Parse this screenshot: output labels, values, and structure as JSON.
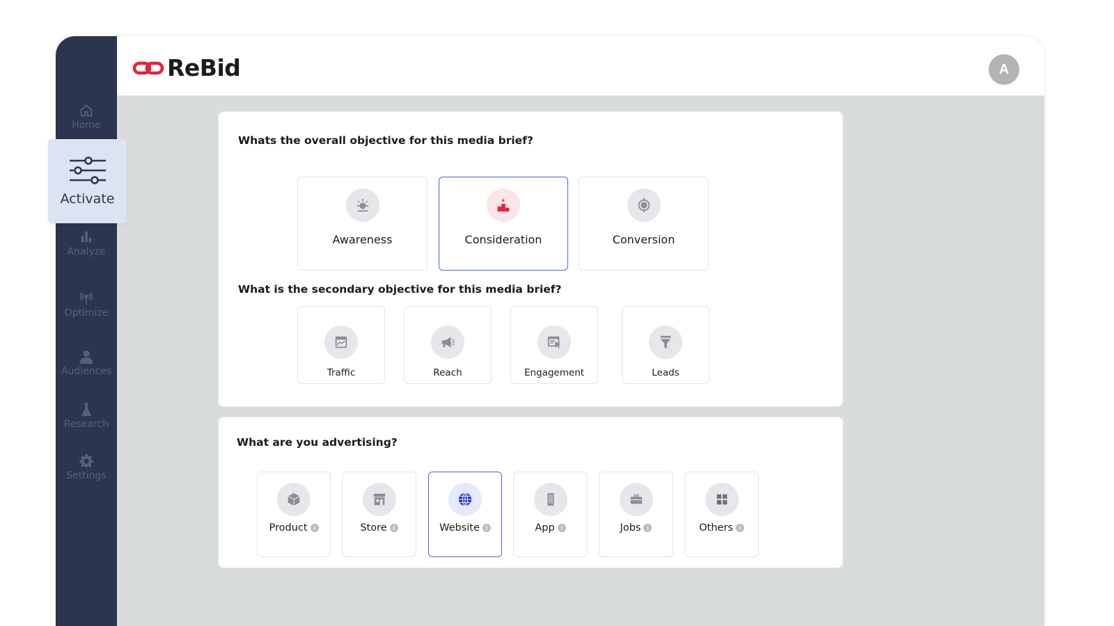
{
  "app": {
    "logo_text": "ReBid",
    "avatar_initial": "A"
  },
  "colors": {
    "sidebar": "#2b3550",
    "accent_blue": "#4a64d8",
    "brand_red": "#e8203a",
    "nav_active_bg": "#dde3f3"
  },
  "sidebar": {
    "items": [
      {
        "label": "Home",
        "icon": "home-icon"
      },
      {
        "label": "Activate",
        "icon": "sliders-icon",
        "active": true
      },
      {
        "label": "Analyze",
        "icon": "bar-chart-icon"
      },
      {
        "label": "Optimize",
        "icon": "broadcast-icon"
      },
      {
        "label": "Audiences",
        "icon": "user-icon"
      },
      {
        "label": "Research",
        "icon": "flask-icon"
      },
      {
        "label": "Settings",
        "icon": "gear-icon"
      }
    ]
  },
  "objective": {
    "question": "Whats the overall objective for this media brief?",
    "options": [
      {
        "label": "Awareness",
        "icon": "sun-icon"
      },
      {
        "label": "Consideration",
        "icon": "podium-icon",
        "selected": true
      },
      {
        "label": "Conversion",
        "icon": "target-icon"
      }
    ]
  },
  "secondary": {
    "question": "What is the secondary objective for this media brief?",
    "options": [
      {
        "label": "Traffic",
        "icon": "traffic-chart-icon"
      },
      {
        "label": "Reach",
        "icon": "megaphone-icon"
      },
      {
        "label": "Engagement",
        "icon": "cursor-window-icon"
      },
      {
        "label": "Leads",
        "icon": "funnel-icon"
      }
    ]
  },
  "advertising": {
    "question": "What are you advertising?",
    "options": [
      {
        "label": "Product",
        "icon": "box-icon"
      },
      {
        "label": "Store",
        "icon": "storefront-icon"
      },
      {
        "label": "Website",
        "icon": "globe-icon",
        "selected": true
      },
      {
        "label": "App",
        "icon": "phone-icon"
      },
      {
        "label": "Jobs",
        "icon": "briefcase-icon"
      },
      {
        "label": "Others",
        "icon": "grid-icon"
      }
    ],
    "info_glyph": "i"
  }
}
